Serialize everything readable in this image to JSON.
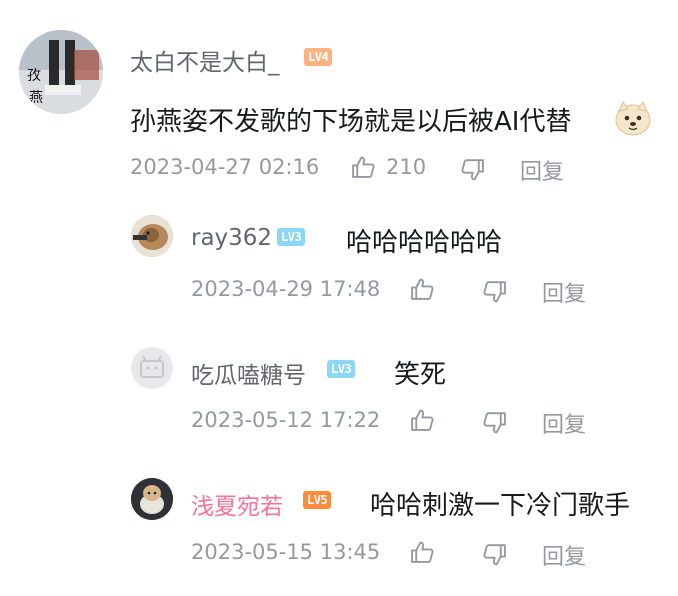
{
  "main_comment": {
    "username": "太白不是大白_",
    "level": "LV4",
    "level_color": "#ffb27f",
    "content": "孙燕姿不发歌的下场就是以后被AI代替",
    "emoji": "doge-emoji",
    "time": "2023-04-27 02:16",
    "likes": "210",
    "reply_label": "回复"
  },
  "replies": [
    {
      "username": "ray362",
      "level": "LV3",
      "level_color": "#8cd6f7",
      "content": "哈哈哈哈哈哈",
      "time": "2023-04-29 17:48",
      "reply_label": "回复"
    },
    {
      "username": "吃瓜嗑糖号",
      "level": "LV3",
      "level_color": "#8cd6f7",
      "content": "笑死",
      "time": "2023-05-12 17:22",
      "reply_label": "回复"
    },
    {
      "username": "浅夏宛若",
      "level": "LV5",
      "level_color": "#ff8c3a",
      "username_color": "#fb7299",
      "content": "哈哈刺激一下冷门歌手",
      "time": "2023-05-15 13:45",
      "reply_label": "回复"
    }
  ]
}
